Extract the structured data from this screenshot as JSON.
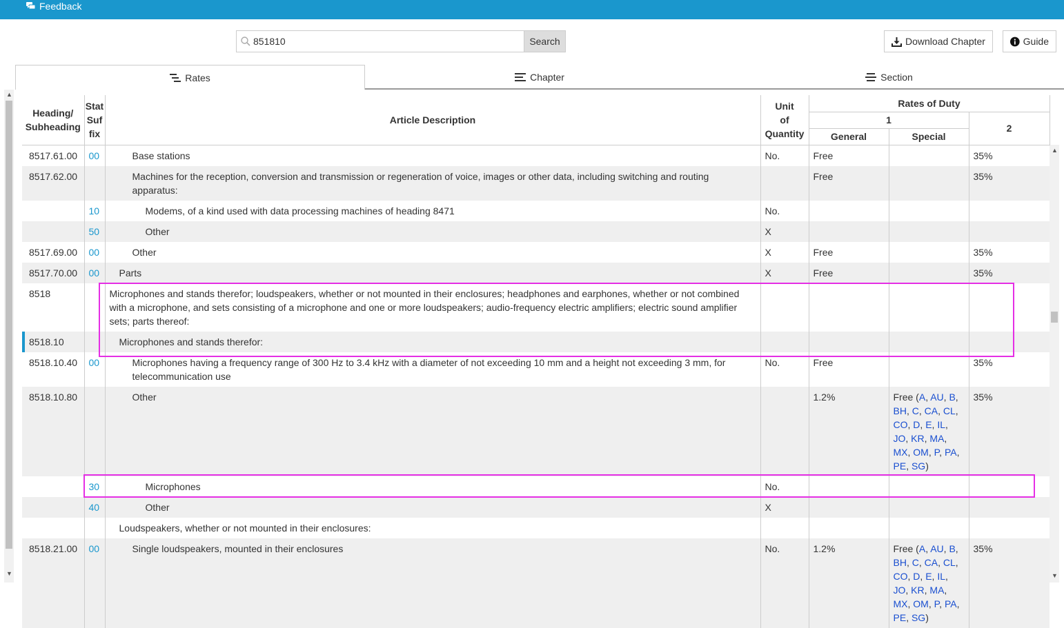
{
  "topbar": {
    "feedback_label": "Feedback"
  },
  "search": {
    "value": "851810",
    "button_label": "Search"
  },
  "buttons": {
    "download_label": "Download Chapter",
    "guide_label": "Guide"
  },
  "tabs": [
    {
      "label": "Rates"
    },
    {
      "label": "Chapter"
    },
    {
      "label": "Section"
    }
  ],
  "table": {
    "headers": {
      "heading_line1": "Heading/",
      "heading_line2": "Subheading",
      "stat_line1": "Stat",
      "stat_line2": "Suf",
      "stat_line3": "fix",
      "description": "Article Description",
      "unit_line1": "Unit",
      "unit_line2": "of",
      "unit_line3": "Quantity",
      "rates": "Rates of Duty",
      "col1": "1",
      "general": "General",
      "special": "Special",
      "col2": "2"
    },
    "rows": [
      {
        "heading": "8517.61.00",
        "stat": "00",
        "indent": 2,
        "desc": "Base stations",
        "unit": "No.",
        "general": "Free",
        "special": "",
        "col2": "35%"
      },
      {
        "heading": "8517.62.00",
        "stat": "",
        "indent": 2,
        "desc": "Machines for the reception, conversion and transmission or regeneration of voice, images or other data, including switching and routing apparatus:",
        "unit": "",
        "general": "Free",
        "special": "",
        "col2": "35%"
      },
      {
        "heading": "",
        "stat": "10",
        "indent": 3,
        "desc": "Modems, of a kind used with data processing machines of heading 8471",
        "unit": "No.",
        "general": "",
        "special": "",
        "col2": ""
      },
      {
        "heading": "",
        "stat": "50",
        "indent": 3,
        "desc": "Other",
        "unit": "X",
        "general": "",
        "special": "",
        "col2": ""
      },
      {
        "heading": "8517.69.00",
        "stat": "00",
        "indent": 2,
        "desc": "Other",
        "unit": "X",
        "general": "Free",
        "special": "",
        "col2": "35%"
      },
      {
        "heading": "8517.70.00",
        "stat": "00",
        "indent": 1,
        "desc": "Parts",
        "unit": "X",
        "general": "Free",
        "special": "",
        "col2": "35%"
      },
      {
        "heading": "8518",
        "stat": "",
        "indent": 0,
        "desc": "Microphones and stands therefor; loudspeakers, whether or not mounted in their enclosures; headphones and earphones, whether or not combined with a microphone, and sets consisting of a microphone and one or more loudspeakers; audio-frequency electric amplifiers; electric sound amplifier sets; parts thereof:",
        "unit": "",
        "general": "",
        "special": "",
        "col2": ""
      },
      {
        "heading": "8518.10",
        "stat": "",
        "indent": 1,
        "desc": "Microphones and stands therefor:",
        "unit": "",
        "general": "",
        "special": "",
        "col2": ""
      },
      {
        "heading": "8518.10.40",
        "stat": "00",
        "indent": 2,
        "desc": "Microphones having a frequency range of 300 Hz to 3.4 kHz with a diameter of not exceeding 10 mm and a height not exceeding 3 mm, for telecommunication use",
        "unit": "No.",
        "general": "Free",
        "special": "",
        "col2": "35%"
      },
      {
        "heading": "8518.10.80",
        "stat": "",
        "indent": 2,
        "desc": "Other",
        "unit": "",
        "general": "1.2%",
        "special_prefix": "Free (",
        "special_codes": [
          "A",
          "AU",
          "B",
          "BH",
          "C",
          "CA",
          "CL",
          "CO",
          "D",
          "E",
          "IL",
          "JO",
          "KR",
          "MA",
          "MX",
          "OM",
          "P",
          "PA",
          "PE",
          "SG"
        ],
        "special_suffix": ")",
        "col2": "35%"
      },
      {
        "heading": "",
        "stat": "30",
        "indent": 3,
        "desc": "Microphones",
        "unit": "No.",
        "general": "",
        "special": "",
        "col2": ""
      },
      {
        "heading": "",
        "stat": "40",
        "indent": 3,
        "desc": "Other",
        "unit": "X",
        "general": "",
        "special": "",
        "col2": ""
      },
      {
        "heading": "",
        "stat": "",
        "indent": 1,
        "desc": "Loudspeakers, whether or not mounted in their enclosures:",
        "unit": "",
        "general": "",
        "special": "",
        "col2": ""
      },
      {
        "heading": "8518.21.00",
        "stat": "00",
        "indent": 2,
        "desc": "Single loudspeakers, mounted in their enclosures",
        "unit": "No.",
        "general": "1.2%",
        "special_prefix": "Free (",
        "special_codes": [
          "A",
          "AU",
          "B",
          "BH",
          "C",
          "CA",
          "CL",
          "CO",
          "D",
          "E",
          "IL",
          "JO",
          "KR",
          "MA",
          "MX",
          "OM",
          "P",
          "PA",
          "PE",
          "SG"
        ],
        "special_suffix": ")",
        "col2": "35%"
      }
    ]
  }
}
